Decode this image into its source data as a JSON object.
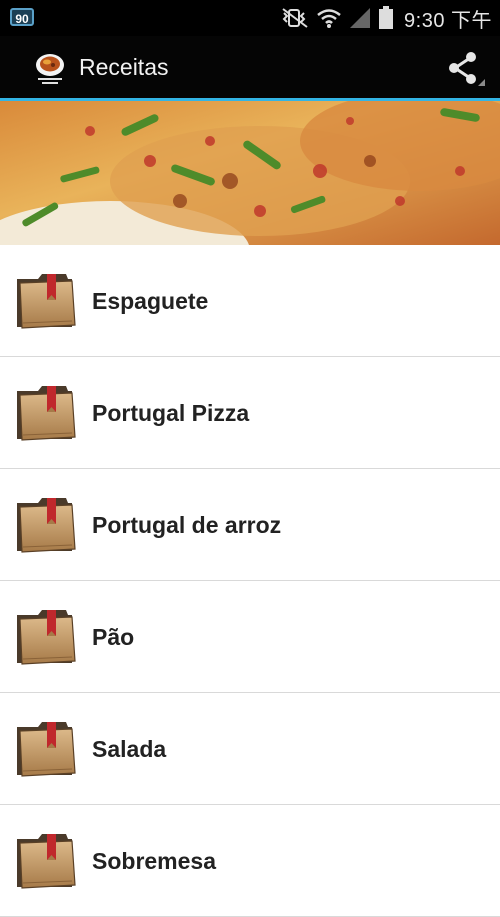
{
  "status_bar": {
    "notification_badge": "90",
    "icons": [
      "mute-vibrate-icon",
      "wifi-icon",
      "signal-icon",
      "battery-icon"
    ],
    "time": "9:30 下午"
  },
  "action_bar": {
    "title": "Receitas",
    "app_icon": "recipe-logo-icon",
    "share_icon": "share-icon"
  },
  "banner": {
    "image": "fried-rice-photo"
  },
  "recipes": [
    {
      "label": "Espaguete",
      "icon": "folder-icon"
    },
    {
      "label": "Portugal Pizza",
      "icon": "folder-icon"
    },
    {
      "label": "Portugal de arroz",
      "icon": "folder-icon"
    },
    {
      "label": "Pão",
      "icon": "folder-icon"
    },
    {
      "label": "Salada",
      "icon": "folder-icon"
    },
    {
      "label": "Sobremesa",
      "icon": "folder-icon"
    }
  ],
  "colors": {
    "accent": "#33b5e5",
    "action_bar": "#050505",
    "divider": "#d9d9d9"
  }
}
